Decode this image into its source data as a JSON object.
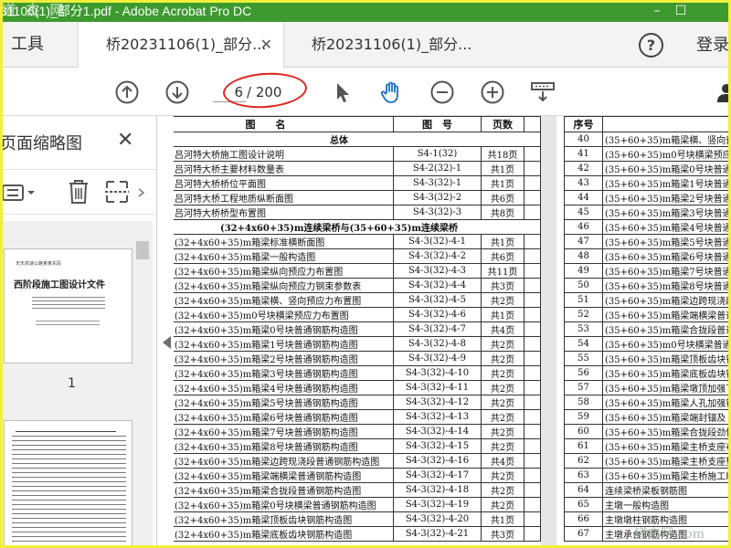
{
  "window": {
    "title": "31106(1)_部分1.pdf - Adobe Acrobat Pro DC",
    "watermark": "道 杰 网",
    "minimize": "–",
    "maximize": "☐"
  },
  "tabs": {
    "tools": "工具",
    "doc_tabs": [
      {
        "label": "桥20231106(1)_部分...",
        "close": "✕"
      },
      {
        "label": "桥20231106(1)_部分..."
      }
    ],
    "help": "?",
    "login": "登录"
  },
  "toolbar": {
    "page_current": "6",
    "page_total": "/ 200"
  },
  "thumbnails": {
    "title": "页面缩略图",
    "close": "✕",
    "page1_number": "1",
    "page1_heading": "西阶段施工图设计文件",
    "page1_org": "天天高速公路某某东段"
  },
  "doc_left": {
    "headers": [
      "图　　名",
      "图　号",
      "页数"
    ],
    "sections": {
      "overall": "总体",
      "bridge": "(32+4x60+35)m连续梁桥与(35+60+35)m连续梁桥"
    },
    "rows_top": [
      [
        "吕河特大桥施工图设计说明",
        "S4-1(32)",
        "共18页"
      ],
      [
        "吕河特大桥主要材料数量表",
        "S4-2(32)-1",
        "共1页"
      ],
      [
        "吕河特大桥桥位平面图",
        "S4-3(32)-1",
        "共1页"
      ],
      [
        "吕河特大桥工程地质纵断面图",
        "S4-3(32)-2",
        "共6页"
      ],
      [
        "吕河特大桥桥型布置图",
        "S4-3(32)-3",
        "共8页"
      ]
    ],
    "rows": [
      [
        "(32+4x60+35)m箱梁标准横断面图",
        "S4-3(32)-4-1",
        "共1页"
      ],
      [
        "(32+4x60+35)m箱梁一般构造图",
        "S4-3(32)-4-2",
        "共6页"
      ],
      [
        "(32+4x60+35)m箱梁纵向预应力布置图",
        "S4-3(32)-4-3",
        "共11页"
      ],
      [
        "(32+4x60+35)m箱梁纵向预应力钢束参数表",
        "S4-3(32)-4-4",
        "共3页"
      ],
      [
        "(32+4x60+35)m箱梁横、竖向预应力布置图",
        "S4-3(32)-4-5",
        "共2页"
      ],
      [
        "(32+4x60+35)m0号块横梁预应力布置图",
        "S4-3(32)-4-6",
        "共1页"
      ],
      [
        "(32+4x60+35)m箱梁0号块普通钢筋构造图",
        "S4-3(32)-4-7",
        "共4页"
      ],
      [
        "(32+4x60+35)m箱梁1号块普通钢筋构造图",
        "S4-3(32)-4-8",
        "共2页"
      ],
      [
        "(32+4x60+35)m箱梁2号块普通钢筋构造图",
        "S4-3(32)-4-9",
        "共2页"
      ],
      [
        "(32+4x60+35)m箱梁3号块普通钢筋构造图",
        "S4-3(32)-4-10",
        "共2页"
      ],
      [
        "(32+4x60+35)m箱梁4号块普通钢筋构造图",
        "S4-3(32)-4-11",
        "共2页"
      ],
      [
        "(32+4x60+35)m箱梁5号块普通钢筋构造图",
        "S4-3(32)-4-12",
        "共2页"
      ],
      [
        "(32+4x60+35)m箱梁6号块普通钢筋构造图",
        "S4-3(32)-4-13",
        "共2页"
      ],
      [
        "(32+4x60+35)m箱梁7号块普通钢筋构造图",
        "S4-3(32)-4-14",
        "共2页"
      ],
      [
        "(32+4x60+35)m箱梁8号块普通钢筋构造图",
        "S4-3(32)-4-15",
        "共2页"
      ],
      [
        "(32+4x60+35)m箱梁边跨现浇段普通钢筋构造图",
        "S4-3(32)-4-16",
        "共4页"
      ],
      [
        "(32+4x60+35)m箱梁端横梁普通钢筋构造图",
        "S4-3(32)-4-17",
        "共2页"
      ],
      [
        "(32+4x60+35)m箱梁合拢段普通钢筋构造图",
        "S4-3(32)-4-18",
        "共2页"
      ],
      [
        "(32+4x60+35)m箱梁0号块横梁普通钢筋构造图",
        "S4-3(32)-4-19",
        "共2页"
      ],
      [
        "(32+4x60+35)m箱梁顶板齿块钢筋构造图",
        "S4-3(32)-4-20",
        "共1页"
      ],
      [
        "(32+4x60+35)m箱梁底板齿块钢筋构造图",
        "S4-3(32)-4-21",
        "共3页"
      ]
    ]
  },
  "doc_right": {
    "header": "序号",
    "rows": [
      [
        "40",
        "(35+60+35)m箱梁横、竖向预"
      ],
      [
        "41",
        "(35+60+35)m0号块横梁预应力布"
      ],
      [
        "42",
        "(35+60+35)m箱梁0号块普通钢筋"
      ],
      [
        "43",
        "(35+60+35)m箱梁1号块普通钢筋"
      ],
      [
        "44",
        "(35+60+35)m箱梁2号块普通钢筋"
      ],
      [
        "45",
        "(35+60+35)m箱梁3号块普通钢筋"
      ],
      [
        "46",
        "(35+60+35)m箱梁4号块普通钢筋"
      ],
      [
        "47",
        "(35+60+35)m箱梁5号块普通钢筋"
      ],
      [
        "48",
        "(35+60+35)m箱梁6号块普通钢筋"
      ],
      [
        "49",
        "(35+60+35)m箱梁7号块普通钢筋"
      ],
      [
        "50",
        "(35+60+35)m箱梁8号块普通钢筋"
      ],
      [
        "51",
        "(35+60+35)m箱梁边跨现浇段普"
      ],
      [
        "52",
        "(35+60+35)m箱梁端横梁普通钢"
      ],
      [
        "53",
        "(35+60+35)m箱梁合拢段普通钢"
      ],
      [
        "54",
        "(35+60+35)m0号块横梁普通钢"
      ],
      [
        "55",
        "(35+60+35)m箱梁顶板齿块钢筋"
      ],
      [
        "56",
        "(35+60+35)m箱梁底板齿块钢筋"
      ],
      [
        "57",
        "(35+60+35)m箱梁墩顶加强下钢"
      ],
      [
        "58",
        "(35+60+35)m箱梁人孔加强钢筋"
      ],
      [
        "59",
        "(35+60+35)m箱梁端封锚及"
      ],
      [
        "60",
        "(35+60+35)m箱梁合拢段劲性"
      ],
      [
        "61",
        "(35+60+35)m箱梁主桥支座布"
      ],
      [
        "62",
        "(35+60+35)m箱梁主桥支座垫石"
      ],
      [
        "63",
        "(35+60+35)m箱梁主桥施工顺序"
      ],
      [
        "64",
        "连续梁桥梁板钢筋图"
      ],
      [
        "65",
        "主墩一般构造图"
      ],
      [
        "66",
        "主墩墩柱钢筋构造图"
      ],
      [
        "67",
        "主墩承台钢筋构造图"
      ]
    ]
  },
  "bottom_watermark": "道杰网 com"
}
